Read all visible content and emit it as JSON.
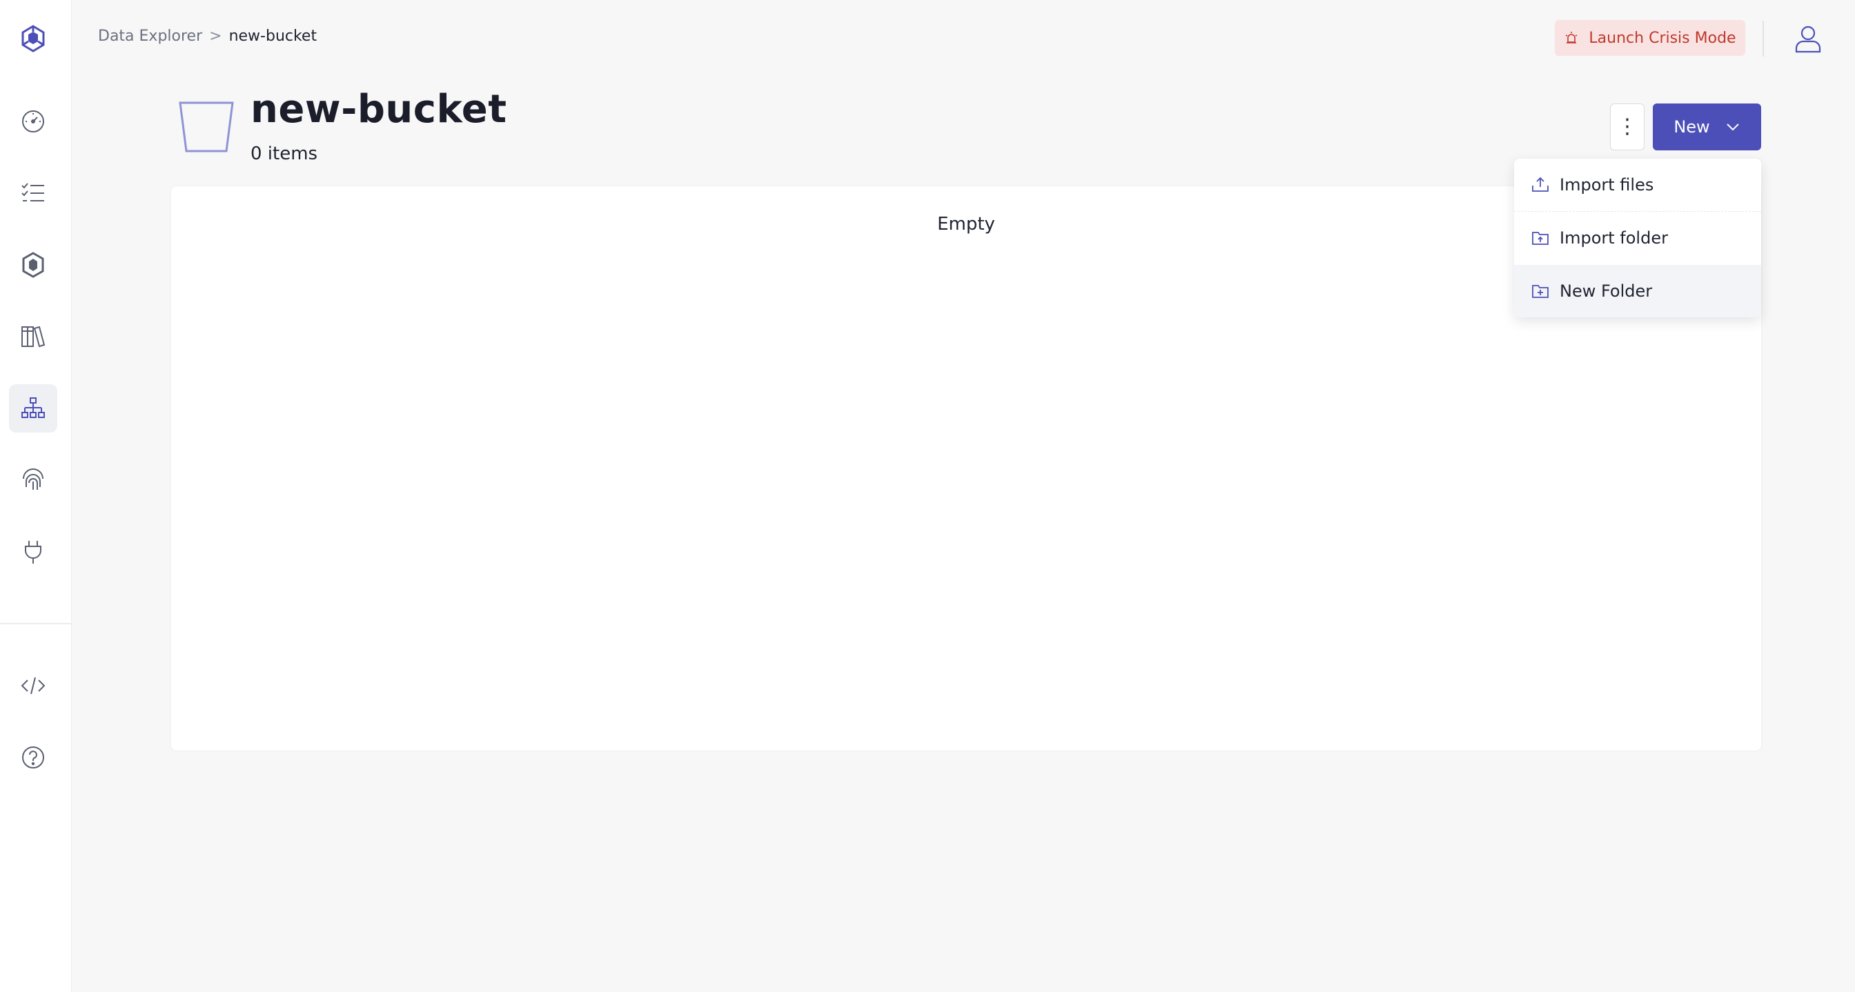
{
  "breadcrumb": {
    "parent": "Data Explorer",
    "separator": ">",
    "current": "new-bucket"
  },
  "topbar": {
    "crisis_label": "Launch Crisis Mode"
  },
  "header": {
    "title": "new-bucket",
    "item_count": "0 items"
  },
  "actions": {
    "more_symbol": "⋮",
    "new_label": "New"
  },
  "dropdown": {
    "items": [
      {
        "label": "Import files",
        "icon": "upload-icon"
      },
      {
        "label": "Import folder",
        "icon": "folder-upload-icon"
      },
      {
        "label": "New Folder",
        "icon": "folder-plus-icon"
      }
    ]
  },
  "content": {
    "empty_label": "Empty"
  },
  "sidebar": {
    "items": [
      {
        "icon": "logo-icon"
      },
      {
        "icon": "dashboard-gauge-icon"
      },
      {
        "icon": "task-list-icon"
      },
      {
        "icon": "hexagon-cluster-icon"
      },
      {
        "icon": "library-books-icon"
      },
      {
        "icon": "hierarchy-icon",
        "active": true
      },
      {
        "icon": "fingerprint-icon"
      },
      {
        "icon": "plug-icon"
      },
      {
        "icon": "code-icon"
      },
      {
        "icon": "help-icon"
      }
    ]
  },
  "colors": {
    "accent": "#4c4fb8",
    "icon": "#5a6070",
    "crisis_bg": "#f9e2e2",
    "crisis_text": "#c0392b"
  }
}
